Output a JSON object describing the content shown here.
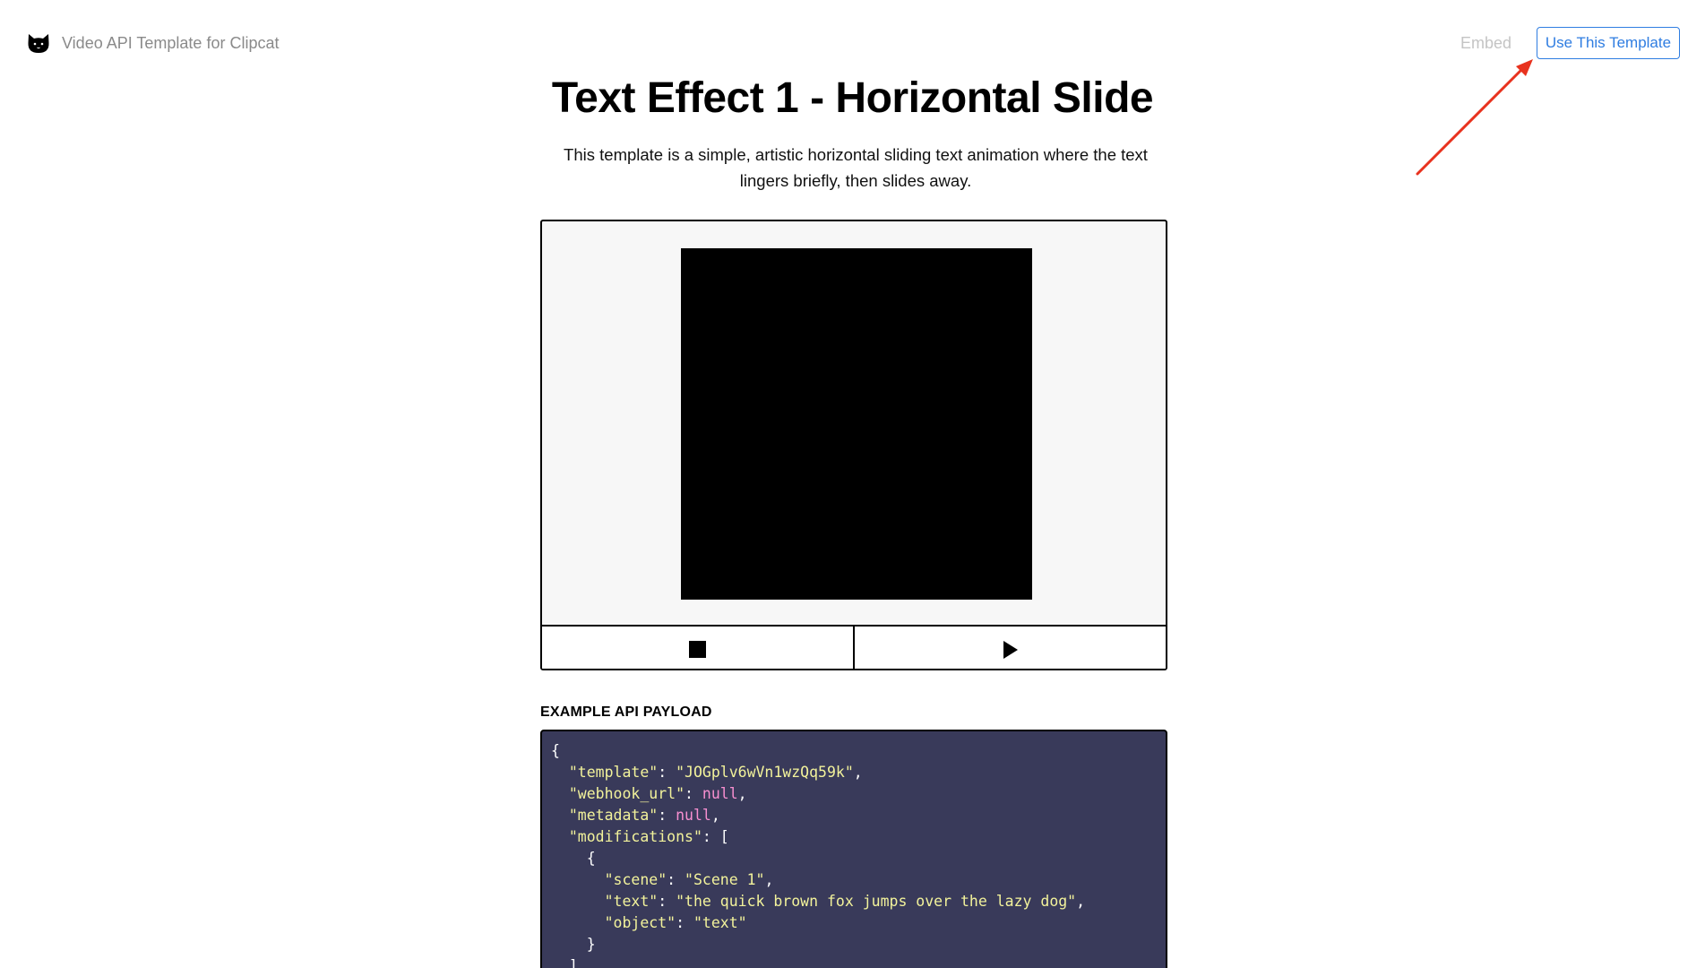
{
  "header": {
    "brand_text": "Video API Template for Clipcat",
    "embed_label": "Embed",
    "use_template_label": "Use This Template"
  },
  "main": {
    "title": "Text Effect 1 - Horizontal Slide",
    "description": "This template is a simple, artistic horizontal sliding text animation where the text lingers briefly, then slides away."
  },
  "payload": {
    "label": "EXAMPLE API PAYLOAD",
    "open_brace": "{",
    "template_key": "\"template\"",
    "template_value": "\"JOGplv6wVn1wzQq59k\"",
    "webhook_key": "\"webhook_url\"",
    "webhook_value": "null",
    "metadata_key": "\"metadata\"",
    "metadata_value": "null",
    "modifications_key": "\"modifications\"",
    "scene_key": "\"scene\"",
    "scene_value": "\"Scene 1\"",
    "text_key": "\"text\"",
    "text_value": "\"the quick brown fox jumps over the lazy dog\"",
    "object_key": "\"object\"",
    "object_value": "\"text\""
  },
  "icons": {
    "brand": "cat-icon",
    "stop": "stop-icon",
    "play": "play-icon",
    "annotation": "arrow-icon"
  },
  "colors": {
    "accent": "#2f7de1",
    "arrow": "#e8321e",
    "code_bg": "#393a5a",
    "code_string": "#f2f29b",
    "code_null": "#f78fd0"
  }
}
